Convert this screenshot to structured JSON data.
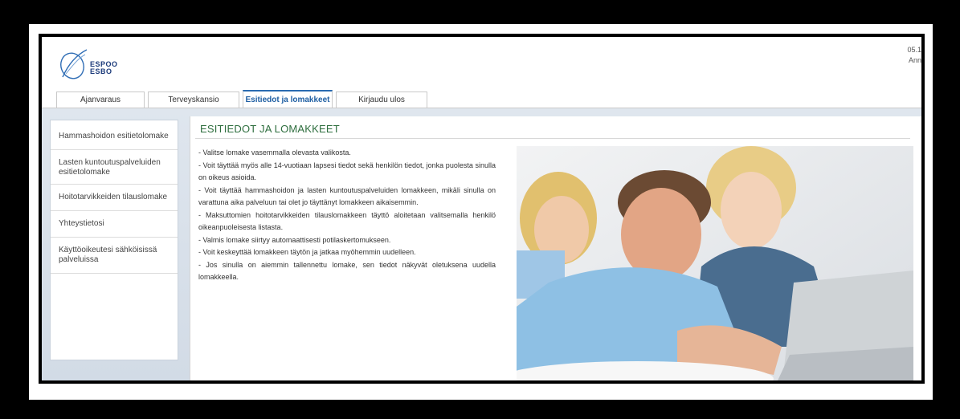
{
  "brand": {
    "line1": "ESPOO",
    "line2": "ESBO"
  },
  "top_right": {
    "line1": "05.1",
    "line2": "Ann"
  },
  "tabs": [
    {
      "label": "Ajanvaraus"
    },
    {
      "label": "Terveyskansio"
    },
    {
      "label": "Esitiedot ja lomakkeet",
      "active": true
    },
    {
      "label": "Kirjaudu ulos"
    }
  ],
  "sidebar": {
    "items": [
      {
        "label": "Hammashoidon esitietolomake"
      },
      {
        "label": "Lasten kuntoutuspalveluiden esitietolomake"
      },
      {
        "label": "Hoitotarvikkeiden tilauslomake"
      },
      {
        "label": "Yhteystietosi"
      },
      {
        "label": "Käyttöoikeutesi sähköisissä palveluissa"
      }
    ]
  },
  "content": {
    "title": "ESITIEDOT JA LOMAKKEET",
    "lines": [
      "- Valitse lomake vasemmalla olevasta valikosta.",
      "- Voit täyttää myös alle 14-vuotiaan lapsesi tiedot sekä henkilön tiedot, jonka puolesta sinulla on oikeus asioida.",
      "- Voit täyttää hammashoidon ja lasten kuntoutuspalveluiden lomakkeen, mikäli sinulla on varattuna aika palveluun tai olet jo täyttänyt lomakkeen aikaisemmin.",
      "- Maksuttomien hoitotarvikkeiden tilauslomakkeen täyttö aloitetaan valitsemalla henkilö oikeanpuoleisesta listasta.",
      "- Valmis lomake siirtyy automaattisesti potilaskertomukseen.",
      "- Voit keskeyttää lomakkeen täytön ja jatkaa myöhemmin uudelleen.",
      "- Jos sinulla on aiemmin tallennettu lomake, sen tiedot näkyvät oletuksena uudella lomakkeella."
    ]
  },
  "colors": {
    "accent_blue": "#1f5fa3",
    "title_green": "#2e6e3e"
  },
  "icons": {
    "logo": "espoo-swirl-logo"
  }
}
